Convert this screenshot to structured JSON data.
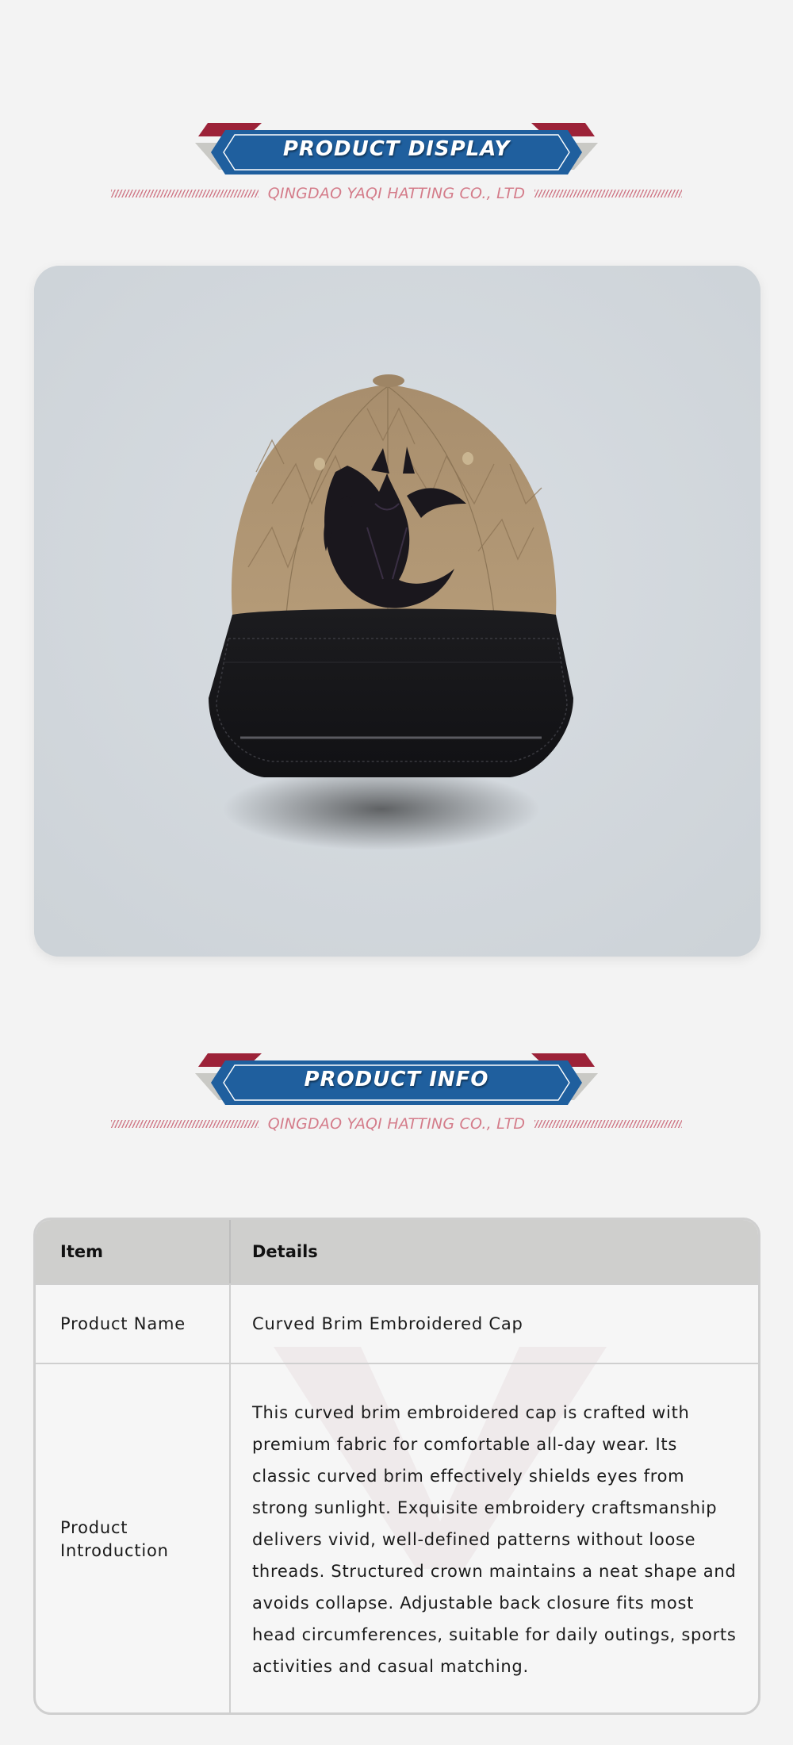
{
  "sections": {
    "display_title": "PRODUCT DISPLAY",
    "info_title": "PRODUCT INFO",
    "company": "QINGDAO YAQI HATTING CO., LTD"
  },
  "colors": {
    "page_background": "#f3f3f3",
    "banner_blue": "#1f5f9e",
    "banner_red": "#9c2238",
    "banner_grey": "#c9c9c5",
    "company_pink": "#d47c8a",
    "photo_background": "#d3d8dd",
    "table_header": "#cfcfcd"
  },
  "photo": {
    "subject": "baseball cap, tan crown with embroidered black horse head, black curved brim"
  },
  "table": {
    "headers": {
      "item": "Item",
      "details": "Details"
    },
    "rows": [
      {
        "item": "Product Name",
        "details": "Curved Brim Embroidered Cap"
      },
      {
        "item": "Product Introduction",
        "details": "This curved brim embroidered cap is crafted with premium fabric for comfortable all-day wear. Its classic curved brim effectively shields eyes from strong sunlight. Exquisite embroidery craftsmanship delivers vivid, well-defined patterns without loose threads. Structured crown maintains a neat shape and avoids collapse. Adjustable back closure fits most head circumferences, suitable for daily outings, sports activities and casual matching."
      }
    ]
  }
}
